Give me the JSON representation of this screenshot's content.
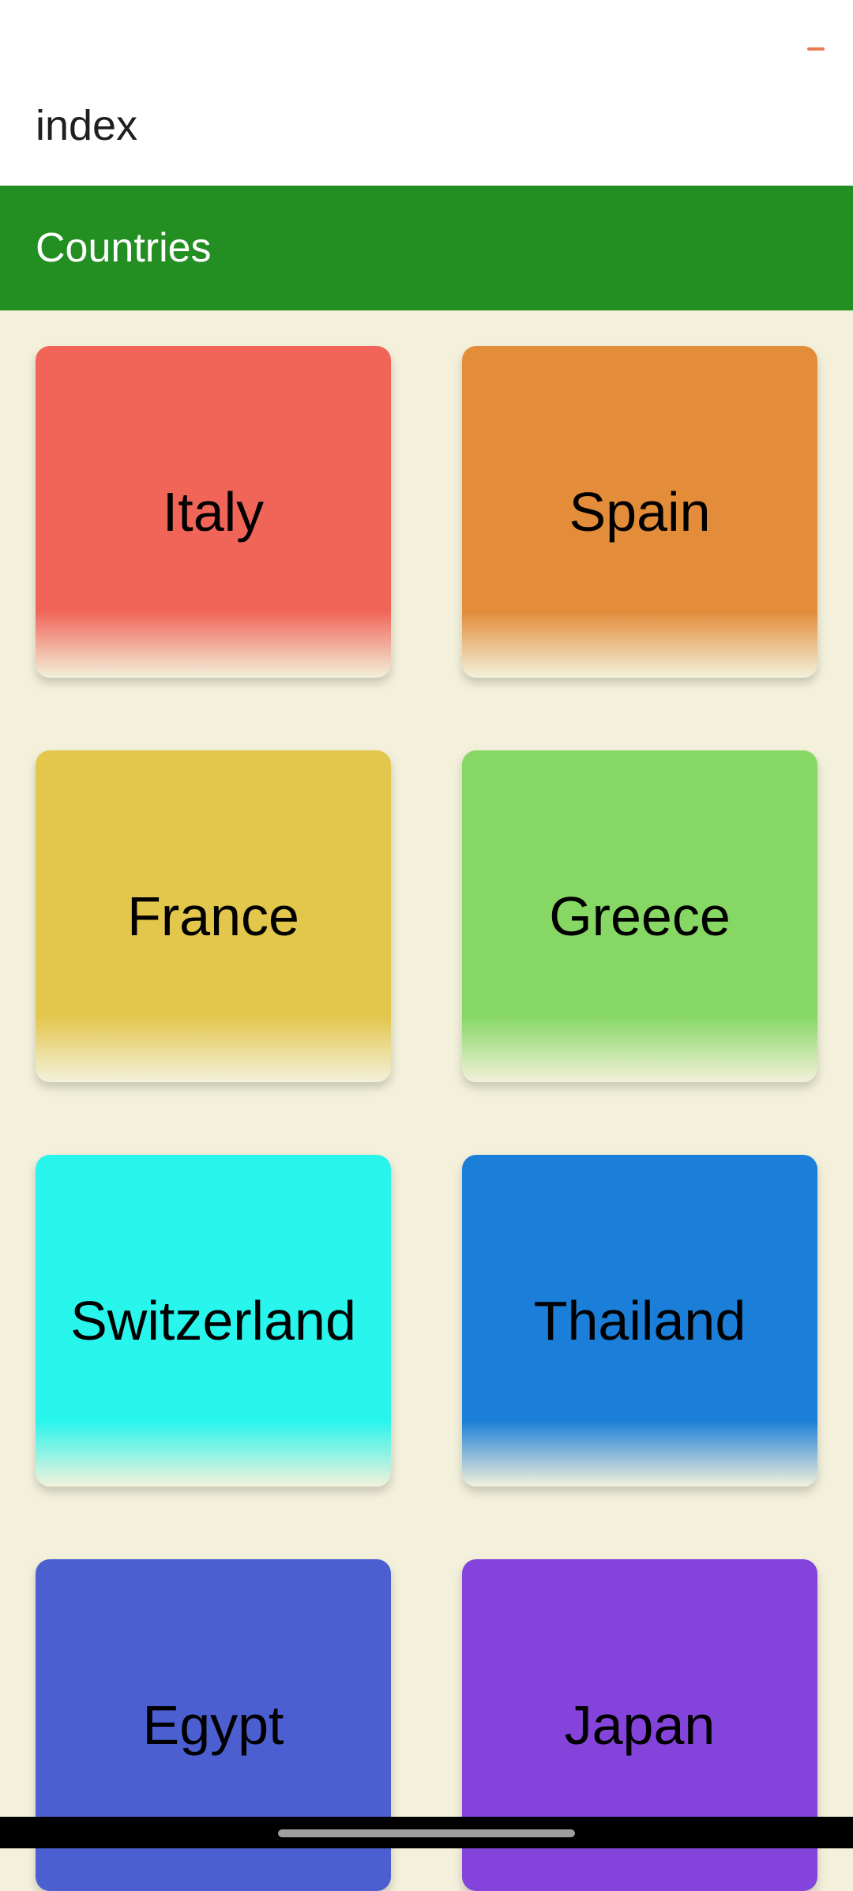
{
  "header": {
    "title": "index"
  },
  "app_bar": {
    "title": "Countries",
    "color": "#238e22"
  },
  "page": {
    "background": "#f3f1db",
    "status_indicator_color": "#e97a4f"
  },
  "countries": [
    {
      "name": "Italy",
      "color": "#f16559"
    },
    {
      "name": "Spain",
      "color": "#e38c3a"
    },
    {
      "name": "France",
      "color": "#e3c64c"
    },
    {
      "name": "Greece",
      "color": "#86d764"
    },
    {
      "name": "Switzerland",
      "color": "#28f5ec"
    },
    {
      "name": "Thailand",
      "color": "#1b7ed8"
    },
    {
      "name": "Egypt",
      "color": "#4c5fd1"
    },
    {
      "name": "Japan",
      "color": "#8443da"
    }
  ]
}
